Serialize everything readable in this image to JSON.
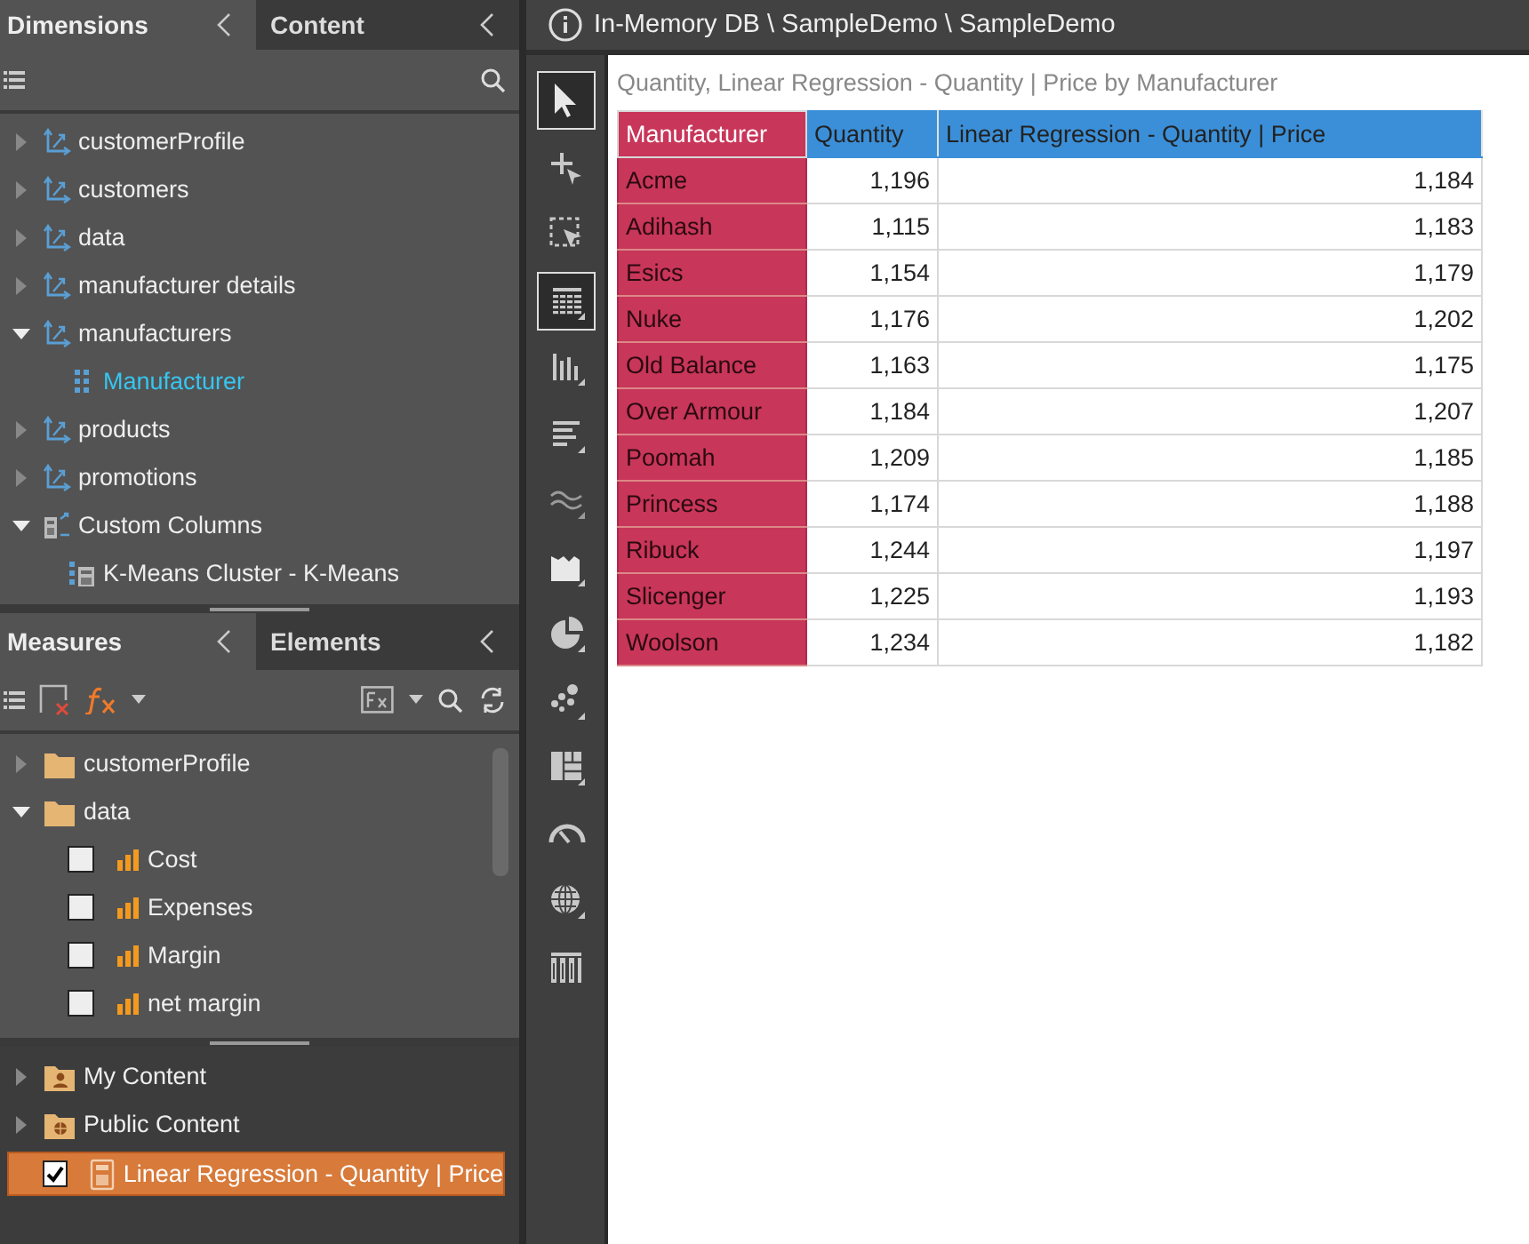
{
  "header": {
    "path": "In-Memory DB \\ SampleDemo \\ SampleDemo"
  },
  "dimensions_panel": {
    "tabs": [
      {
        "label": "Dimensions",
        "selected": true
      },
      {
        "label": "Content",
        "selected": false
      }
    ],
    "tree": [
      {
        "label": "customerProfile",
        "kind": "dimension",
        "expanded": false,
        "selected": false
      },
      {
        "label": "customers",
        "kind": "dimension",
        "expanded": false,
        "selected": false
      },
      {
        "label": "data",
        "kind": "dimension",
        "expanded": false,
        "selected": false
      },
      {
        "label": "manufacturer details",
        "kind": "dimension",
        "expanded": false,
        "selected": false
      },
      {
        "label": "manufacturers",
        "kind": "dimension",
        "expanded": true,
        "selected": false,
        "children": [
          {
            "label": "Manufacturer",
            "kind": "attribute",
            "selected": true
          }
        ]
      },
      {
        "label": "products",
        "kind": "dimension",
        "expanded": false,
        "selected": false
      },
      {
        "label": "promotions",
        "kind": "dimension",
        "expanded": false,
        "selected": false
      },
      {
        "label": "Custom Columns",
        "kind": "custom",
        "expanded": true,
        "selected": false,
        "children": [
          {
            "label": "K-Means Cluster - K-Means",
            "kind": "custom-column",
            "selected": false
          }
        ]
      }
    ]
  },
  "measures_panel": {
    "tabs": [
      {
        "label": "Measures",
        "selected": true
      },
      {
        "label": "Elements",
        "selected": false
      }
    ],
    "tree": [
      {
        "label": "customerProfile",
        "kind": "folder",
        "expanded": false
      },
      {
        "label": "data",
        "kind": "folder",
        "expanded": true,
        "children": [
          {
            "label": "Cost",
            "kind": "measure",
            "checked": false
          },
          {
            "label": "Expenses",
            "kind": "measure",
            "checked": false
          },
          {
            "label": "Margin",
            "kind": "measure",
            "checked": false
          },
          {
            "label": "net margin",
            "kind": "measure",
            "checked": false
          }
        ]
      }
    ]
  },
  "content_tree": [
    {
      "label": "My Content",
      "kind": "user-folder",
      "expanded": false,
      "selected": false
    },
    {
      "label": "Public Content",
      "kind": "public-folder",
      "expanded": false,
      "selected": false
    },
    {
      "label": "Linear Regression - Quantity | Price",
      "kind": "calculation",
      "checked": true,
      "selected": true
    }
  ],
  "tools": [
    {
      "kind": "pointer",
      "selected": true
    },
    {
      "kind": "add",
      "selected": false
    },
    {
      "kind": "marquee",
      "selected": false
    },
    {
      "kind": "table",
      "selected": true
    },
    {
      "kind": "column",
      "selected": false
    },
    {
      "kind": "bar",
      "selected": false
    },
    {
      "kind": "line",
      "selected": false
    },
    {
      "kind": "area",
      "selected": false
    },
    {
      "kind": "pie",
      "selected": false
    },
    {
      "kind": "scatter",
      "selected": false
    },
    {
      "kind": "treemap",
      "selected": false
    },
    {
      "kind": "gauge",
      "selected": false
    },
    {
      "kind": "map",
      "selected": false
    },
    {
      "kind": "pivot",
      "selected": false
    }
  ],
  "report": {
    "title": "Quantity, Linear Regression - Quantity | Price by Manufacturer",
    "table": {
      "columns": [
        {
          "label": "Manufacturer",
          "kind": "dimension"
        },
        {
          "label": "Quantity",
          "kind": "measure"
        },
        {
          "label": "Linear Regression - Quantity | Price",
          "kind": "measure"
        }
      ],
      "rows": [
        [
          "Acme",
          "1,196",
          "1,184"
        ],
        [
          "Adihash",
          "1,115",
          "1,183"
        ],
        [
          "Esics",
          "1,154",
          "1,179"
        ],
        [
          "Nuke",
          "1,176",
          "1,202"
        ],
        [
          "Old Balance",
          "1,163",
          "1,175"
        ],
        [
          "Over Armour",
          "1,184",
          "1,207"
        ],
        [
          "Poomah",
          "1,209",
          "1,185"
        ],
        [
          "Princess",
          "1,174",
          "1,188"
        ],
        [
          "Ribuck",
          "1,244",
          "1,197"
        ],
        [
          "Slicenger",
          "1,225",
          "1,193"
        ],
        [
          "Woolson",
          "1,234",
          "1,182"
        ]
      ]
    }
  }
}
